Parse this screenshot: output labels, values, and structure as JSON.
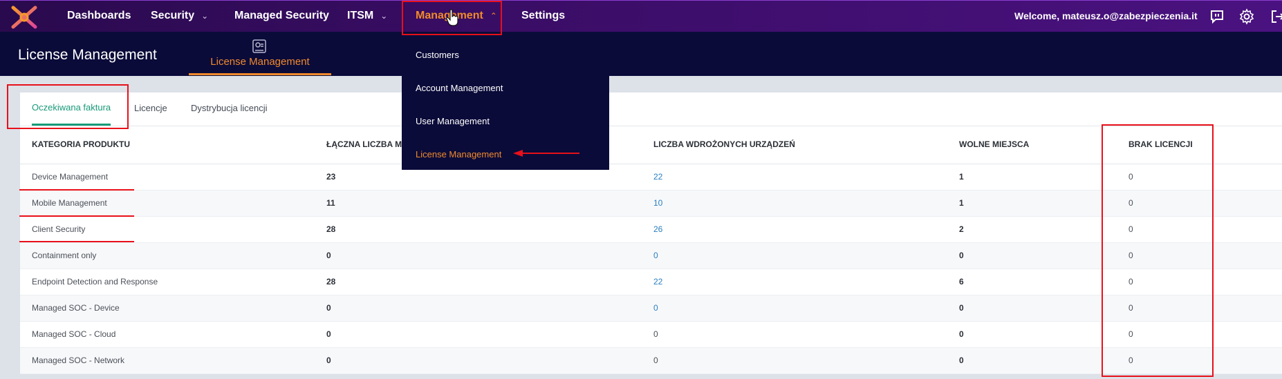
{
  "nav": {
    "items": [
      {
        "label": "Dashboards",
        "has_chevron": false
      },
      {
        "label": "Security",
        "has_chevron": true
      },
      {
        "label": "Managed Security",
        "has_chevron": false
      },
      {
        "label": "ITSM",
        "has_chevron": true
      },
      {
        "label": "Management",
        "has_chevron": true,
        "active": true
      },
      {
        "label": "Settings",
        "has_chevron": false
      }
    ],
    "welcome": "Welcome, mateusz.o@zabezpieczenia.it",
    "icons": [
      "logo-icon",
      "feedback-icon",
      "gear-icon",
      "logout-icon"
    ],
    "accent_color": "#f08a2c"
  },
  "header": {
    "title": "License Management",
    "subtab_label": "License Management"
  },
  "dropdown": {
    "items": [
      {
        "label": "Customers"
      },
      {
        "label": "Account Management"
      },
      {
        "label": "User Management"
      },
      {
        "label": "License Management",
        "active": true
      }
    ]
  },
  "tabs": [
    {
      "label": "Oczekiwana faktura",
      "active": true
    },
    {
      "label": "Licencje"
    },
    {
      "label": "Dystrybucja licencji"
    }
  ],
  "table": {
    "columns": [
      "KATEGORIA PRODUKTU",
      "ŁĄCZNA LICZBA MI",
      "LICZBA WDROŻONYCH URZĄDZEŃ",
      "WOLNE MIEJSCA",
      "BRAK LICENCJI"
    ],
    "rows": [
      [
        "Device Management",
        "23",
        "22",
        "1",
        "0"
      ],
      [
        "Mobile Management",
        "11",
        "10",
        "1",
        "0"
      ],
      [
        "Client Security",
        "28",
        "26",
        "2",
        "0"
      ],
      [
        "Containment only",
        "0",
        "0",
        "0",
        "0"
      ],
      [
        "Endpoint Detection and Response",
        "28",
        "22",
        "6",
        "0"
      ],
      [
        "Managed SOC - Device",
        "0",
        "0",
        "0",
        "0"
      ],
      [
        "Managed SOC - Cloud",
        "0",
        "0",
        "0",
        "0"
      ],
      [
        "Managed SOC - Network",
        "0",
        "0",
        "0",
        "0"
      ]
    ],
    "linked_deployed": [
      true,
      true,
      true,
      true,
      true,
      true,
      false,
      false
    ]
  },
  "annotation_color": "#e8101a"
}
